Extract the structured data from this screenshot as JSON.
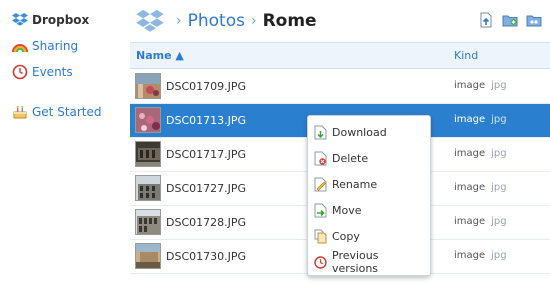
{
  "sidebar": {
    "items": [
      {
        "label": "Dropbox",
        "icon": "dropbox-logo-icon"
      },
      {
        "label": "Sharing",
        "icon": "rainbow-icon"
      },
      {
        "label": "Events",
        "icon": "clock-icon"
      },
      {
        "label": "Get Started",
        "icon": "cake-icon"
      }
    ]
  },
  "breadcrumb": {
    "parent": "Photos",
    "separator": "›",
    "current": "Rome"
  },
  "table": {
    "headers": {
      "name": "Name ▲",
      "kind": "Kind"
    },
    "rows": [
      {
        "name": "DSC01709.JPG",
        "kind": "image",
        "ext": "jpg",
        "selected": false
      },
      {
        "name": "DSC01713.JPG",
        "kind": "image",
        "ext": "jpg",
        "selected": true
      },
      {
        "name": "DSC01717.JPG",
        "kind": "image",
        "ext": "jpg",
        "selected": false
      },
      {
        "name": "DSC01727.JPG",
        "kind": "image",
        "ext": "jpg",
        "selected": false
      },
      {
        "name": "DSC01728.JPG",
        "kind": "image",
        "ext": "jpg",
        "selected": false
      },
      {
        "name": "DSC01730.JPG",
        "kind": "image",
        "ext": "jpg",
        "selected": false
      }
    ]
  },
  "context_menu": {
    "items": [
      {
        "label": "Download",
        "icon": "download-icon"
      },
      {
        "label": "Delete",
        "icon": "delete-icon"
      },
      {
        "label": "Rename",
        "icon": "rename-icon"
      },
      {
        "label": "Move",
        "icon": "move-icon"
      },
      {
        "label": "Copy",
        "icon": "copy-icon"
      },
      {
        "label": "Previous versions",
        "icon": "clock-icon"
      }
    ]
  },
  "colors": {
    "accent": "#2c7ad6",
    "selected_row": "#2b7fcf",
    "header_bg": "#eef4fb"
  }
}
